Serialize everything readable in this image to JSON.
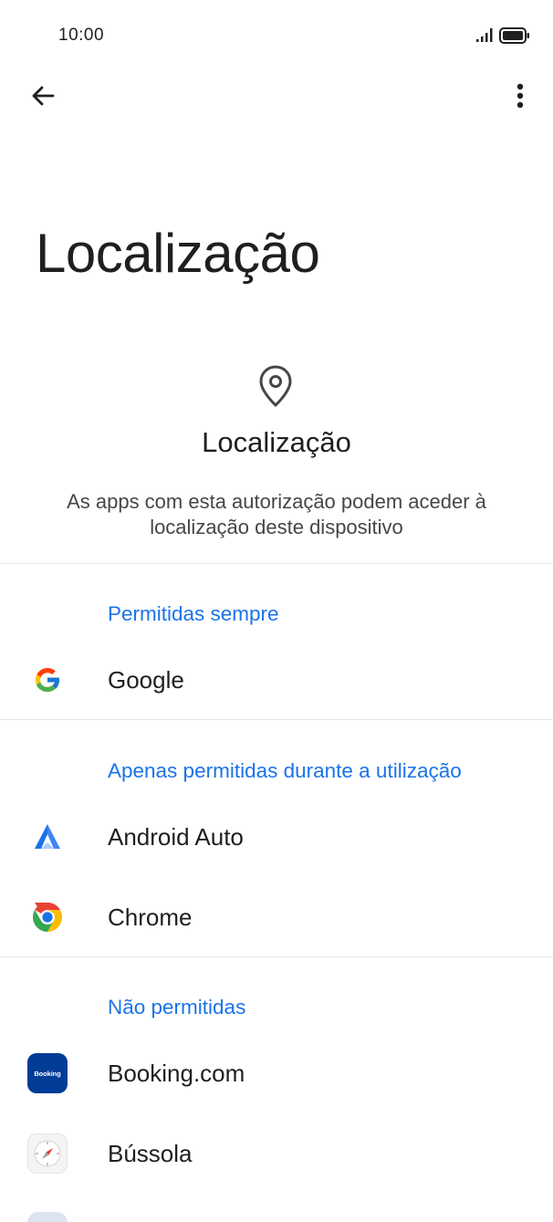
{
  "status_bar": {
    "time": "10:00",
    "signal_icon": "signal-icon",
    "battery_icon": "battery-icon"
  },
  "toolbar": {
    "back_icon": "arrow-back-icon",
    "more_icon": "more-vert-icon"
  },
  "page_title": "Localização",
  "header": {
    "icon": "location-pin-icon",
    "title": "Localização",
    "description": "As apps com esta autorização podem aceder à localização deste dispositivo"
  },
  "groups": [
    {
      "label": "Permitidas sempre",
      "apps": [
        {
          "name": "Google",
          "icon": "google-icon"
        }
      ]
    },
    {
      "label": "Apenas permitidas durante a utilização",
      "apps": [
        {
          "name": "Android Auto",
          "icon": "android-auto-icon"
        },
        {
          "name": "Chrome",
          "icon": "chrome-icon"
        }
      ]
    },
    {
      "label": "Não permitidas",
      "apps": [
        {
          "name": "Booking.com",
          "icon": "booking-icon",
          "icon_text": "Booking"
        },
        {
          "name": "Bússola",
          "icon": "compass-icon"
        }
      ]
    }
  ],
  "colors": {
    "accent": "#1a73e8",
    "text_primary": "#1f1f1f",
    "text_secondary": "#444746",
    "divider": "#e6e6e6",
    "booking_blue": "#003b95"
  }
}
